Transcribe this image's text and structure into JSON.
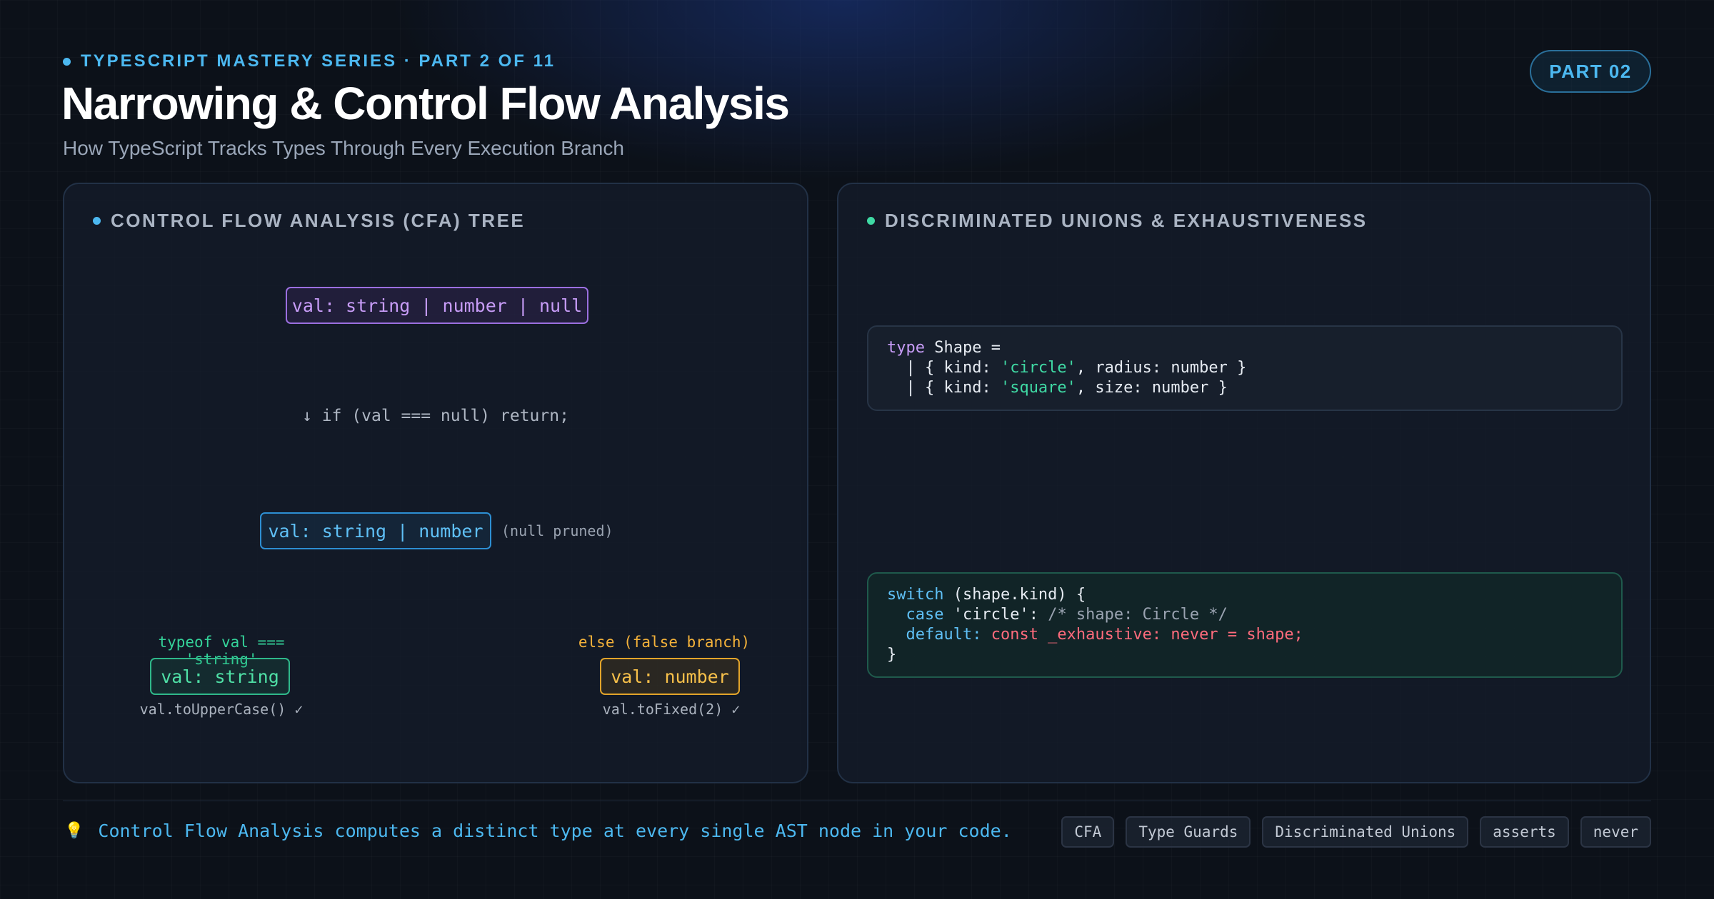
{
  "header": {
    "series": "TYPESCRIPT MASTERY SERIES · PART 2 OF 11",
    "title": "Narrowing & Control Flow Analysis",
    "subtitle": "How TypeScript Tracks Types Through Every Execution Branch",
    "part_badge": "PART 02"
  },
  "left_panel": {
    "heading": "CONTROL FLOW ANALYSIS (CFA) TREE",
    "root_node": "val: string | number | null",
    "if_statement": "↓ if (val === null) return;",
    "narrowed_node": "val: string | number",
    "pruned_note": "(null pruned)",
    "true_branch": {
      "condition": "typeof val === 'string'",
      "node": "val: string",
      "method": "val.toUpperCase() ✓"
    },
    "false_branch": {
      "condition": "else (false branch)",
      "node": "val: number",
      "method": "val.toFixed(2) ✓"
    }
  },
  "right_panel": {
    "heading": "DISCRIMINATED UNIONS & EXHAUSTIVENESS",
    "type_code": {
      "kw_type": "type",
      "line1_rest": " Shape =",
      "line2_pre": "  | { kind: ",
      "line2_str": "'circle'",
      "line2_post": ", radius: number }",
      "line3_pre": "  | { kind: ",
      "line3_str": "'square'",
      "line3_post": ", size: number }"
    },
    "switch_code": {
      "kw_switch": "switch",
      "line1_rest": " (shape.kind) {",
      "case_indent": "  ",
      "kw_case": "case",
      "case_str": " 'circle'",
      "case_colon": ":",
      "case_comment": " /* shape: Circle */",
      "default_indent": "  ",
      "kw_default": "default:",
      "default_rest": " const _exhaustive: never = shape;",
      "closing": "}"
    }
  },
  "footer": {
    "icon": "lightbulb-icon",
    "note": "Control Flow Analysis computes a distinct type at every single AST node in your code.",
    "tags": [
      "CFA",
      "Type Guards",
      "Discriminated Unions",
      "asserts",
      "never"
    ]
  },
  "colors": {
    "accent_blue": "#4cb8f0",
    "purple": "#c79cf7",
    "green": "#3fd9a4",
    "amber": "#f7c04a",
    "red": "#ff6b7c",
    "background": "#0c1119"
  }
}
